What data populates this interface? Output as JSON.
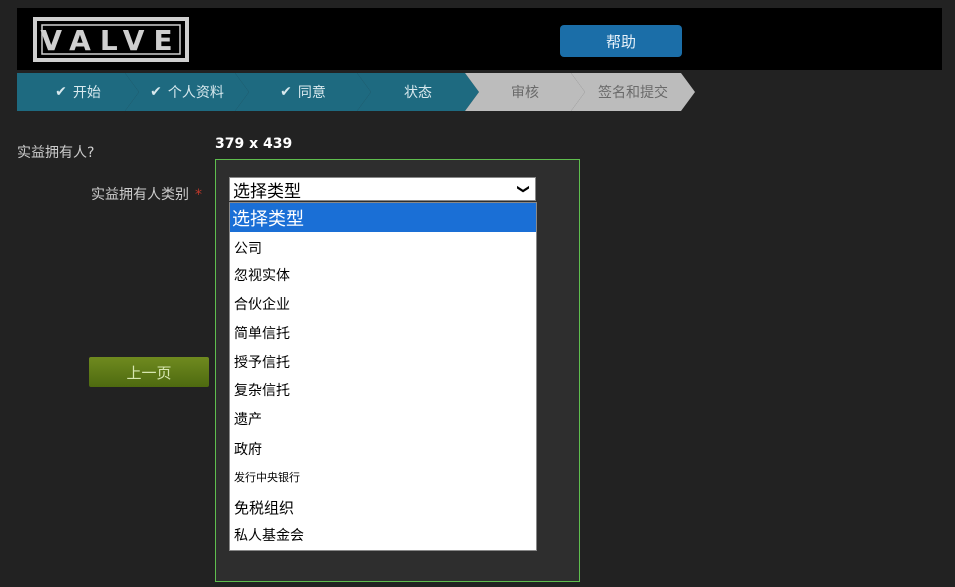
{
  "header": {
    "logo_text": "VALVE",
    "help_label": "帮助"
  },
  "steps": [
    {
      "label": "开始",
      "done": true
    },
    {
      "label": "个人资料",
      "done": true
    },
    {
      "label": "同意",
      "done": true
    },
    {
      "label": "状态",
      "done": false
    },
    {
      "label": "审核",
      "done": false
    },
    {
      "label": "签名和提交",
      "done": false
    }
  ],
  "colors": {
    "step_active": "#1e6a80",
    "step_disabled": "#bcbcbc",
    "help_button": "#1b6ea8",
    "prev_button": "#5f7b18",
    "highlight_border": "#5fbe4e",
    "selected_option": "#1a6fd6"
  },
  "form": {
    "section_question": "实益拥有人?",
    "size_readout": "379 x 439",
    "field_label": "实益拥有人类别",
    "required_mark": "*",
    "select_value": "选择类型",
    "options": [
      "选择类型",
      "公司",
      "忽视实体",
      "合伙企业",
      "简单信托",
      "授予信托",
      "复杂信托",
      "遗产",
      "政府",
      "发行中央银行",
      "免税组织",
      "私人基金会"
    ],
    "prev_label": "上一页"
  }
}
